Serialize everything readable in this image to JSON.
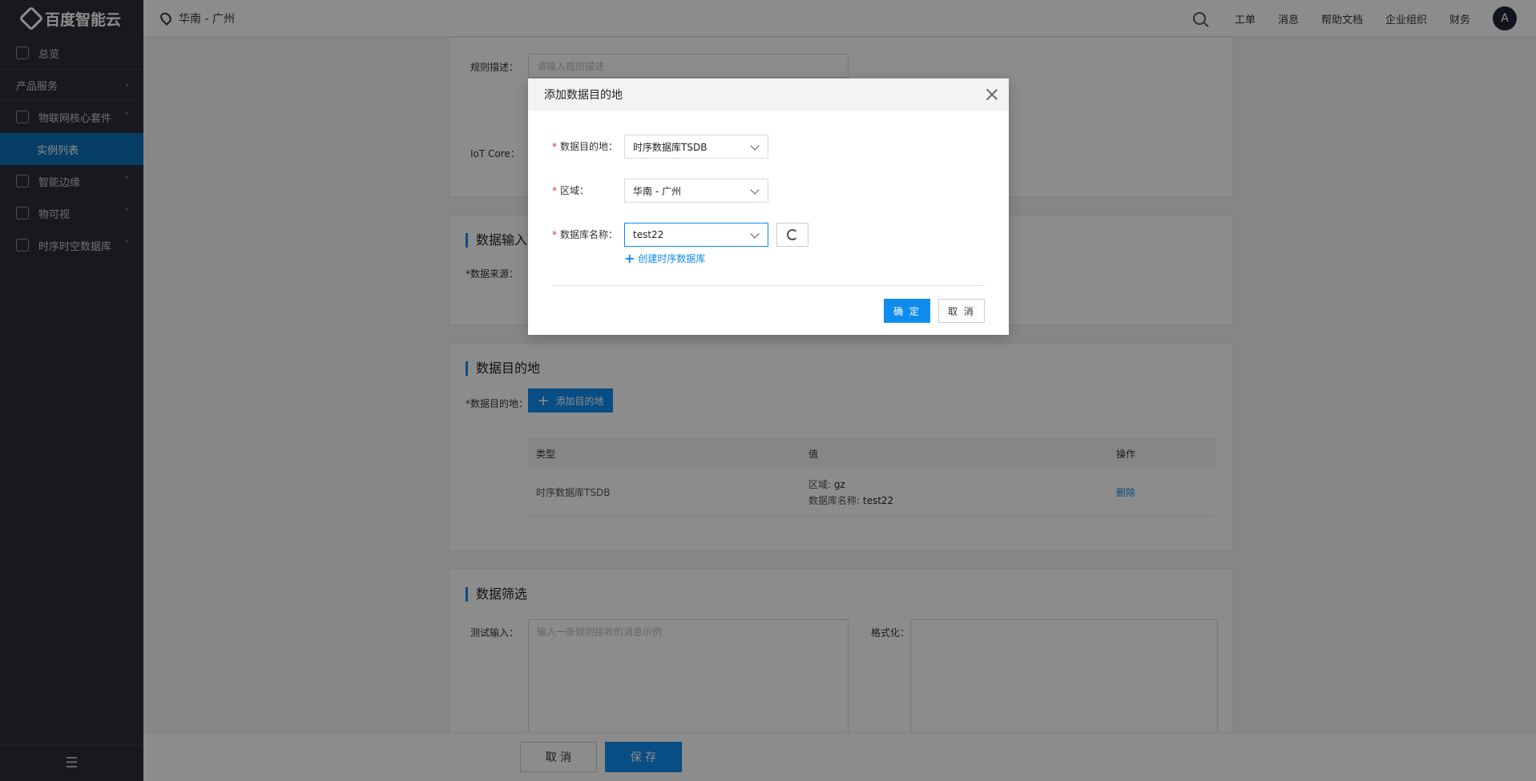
{
  "logo": {
    "text": "百度智能云"
  },
  "sidebar": {
    "overview": "总览",
    "products": "产品服务",
    "iot_core_suite": "物联网核心套件",
    "instance_list": "实例列表",
    "edge": "智能边缘",
    "visual": "物可视",
    "tsdb": "时序时空数据库"
  },
  "topbar": {
    "region": "华南 - 广州",
    "ticket": "工单",
    "messages": "消息",
    "help": "帮助文档",
    "org": "企业组织",
    "finance": "财务",
    "avatar": "A"
  },
  "main": {
    "rule_desc_label": "规则描述：",
    "rule_desc_placeholder": "请输入规则描述",
    "iot_core_label": "IoT Core：",
    "data_input_title": "数据输入",
    "data_source_label": "*数据来源：",
    "dest_title": "数据目的地",
    "dest_label": "*数据目的地：",
    "add_dest_button": "添加目的地",
    "table": {
      "headers": [
        "类型",
        "值",
        "操作"
      ],
      "row": {
        "type": "时序数据库TSDB",
        "region_label": "区域:",
        "region_value": "gz",
        "db_label": "数据库名称:",
        "db_value": "test22",
        "action": "删除"
      }
    },
    "filter_title": "数据筛选",
    "test_input_label": "测试输入：",
    "test_input_placeholder": "输入一条规则接收的消息示例",
    "format_label": "格式化："
  },
  "bottom": {
    "cancel": "取 消",
    "save": "保 存"
  },
  "modal": {
    "title": "添加数据目的地",
    "dest_label": "数据目的地：",
    "dest_value": "时序数据库TSDB",
    "region_label": "区域：",
    "region_value": "华南 - 广州",
    "db_label": "数据库名称：",
    "db_value": "test22",
    "create_link": "创建时序数据库",
    "ok": "确 定",
    "cancel": "取 消",
    "required_mark": "*"
  }
}
